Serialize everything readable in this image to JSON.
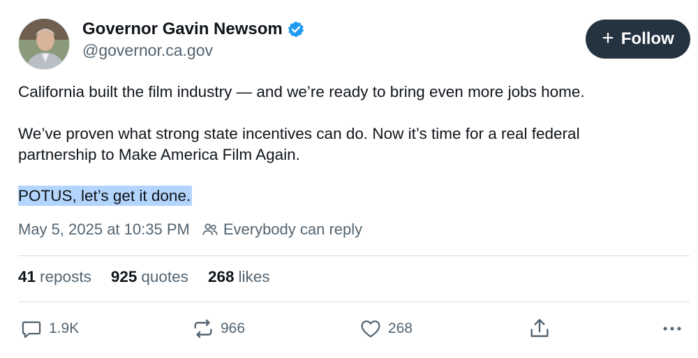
{
  "author": {
    "display_name": "Governor Gavin Newsom",
    "handle": "@governor.ca.gov",
    "verified": true,
    "verified_color": "#1d9bf0"
  },
  "follow_button": {
    "icon": "plus-icon",
    "label": "Follow",
    "background": "#253341"
  },
  "post": {
    "lines": [
      "California built the film industry — and we’re ready to bring even more jobs home.",
      "We’ve proven what strong state incentives can do. Now it’s time for a real federal",
      "partnership to Make America Film Again.",
      "POTUS, let’s get it done."
    ],
    "highlight_color": "#b3d4fc"
  },
  "meta": {
    "timestamp": "May 5, 2025 at 10:35 PM",
    "reply_setting": "Everybody can reply"
  },
  "stats": [
    {
      "count": "41",
      "label": "reposts"
    },
    {
      "count": "925",
      "label": "quotes"
    },
    {
      "count": "268",
      "label": "likes"
    }
  ],
  "actions": {
    "reply": {
      "icon": "reply-icon",
      "count": "1.9K"
    },
    "repost": {
      "icon": "repost-icon",
      "count": "966"
    },
    "like": {
      "icon": "heart-icon",
      "count": "268"
    },
    "share": {
      "icon": "share-icon"
    },
    "more": {
      "icon": "more-icon"
    }
  }
}
